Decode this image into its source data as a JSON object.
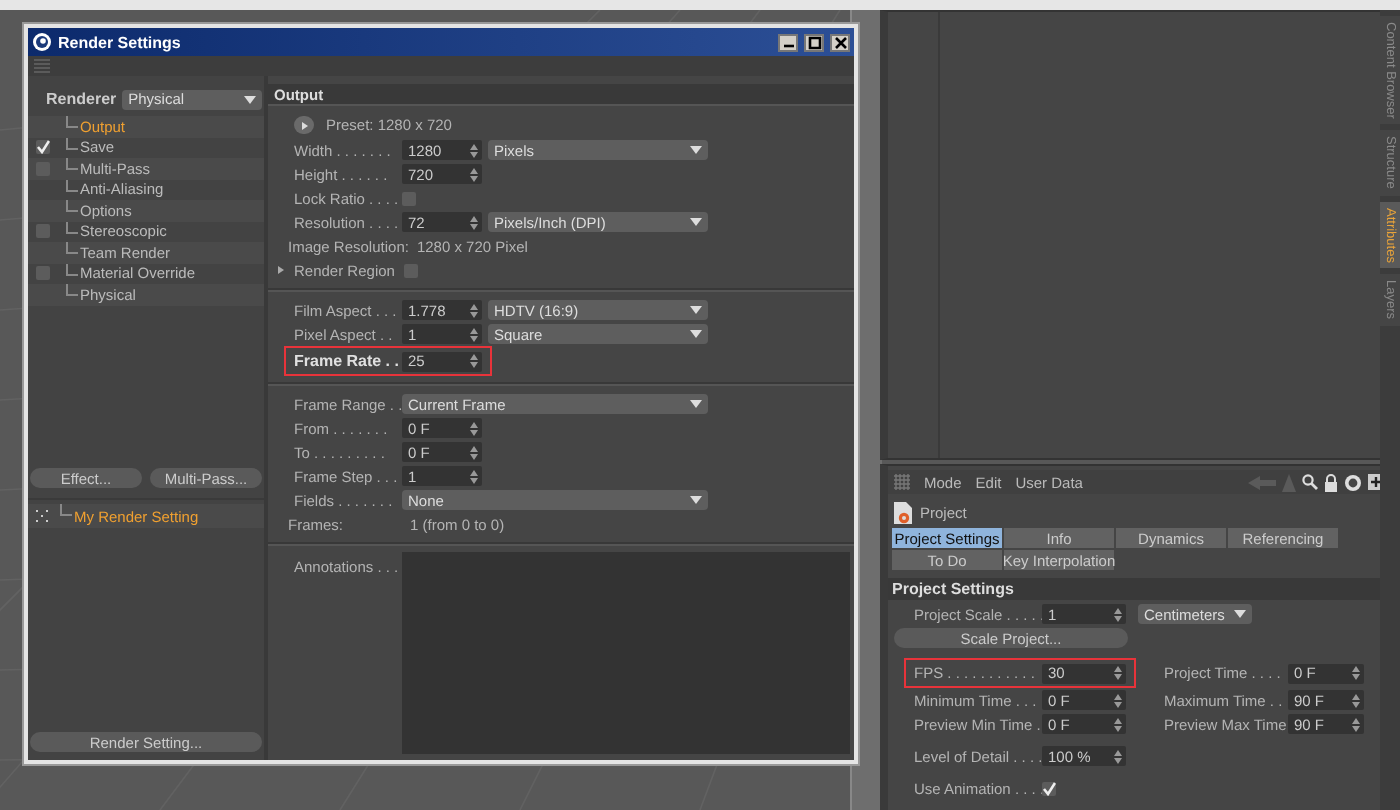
{
  "render_window": {
    "title": "Render Settings",
    "renderer": {
      "label": "Renderer",
      "value": "Physical"
    },
    "effects": [
      {
        "label": "Output",
        "kind": "plain",
        "selected": true
      },
      {
        "label": "Save",
        "kind": "check",
        "checked": true,
        "selected": false
      },
      {
        "label": "Multi-Pass",
        "kind": "check",
        "checked": false,
        "selected": false
      },
      {
        "label": "Anti-Aliasing",
        "kind": "plain",
        "selected": false
      },
      {
        "label": "Options",
        "kind": "plain",
        "selected": false
      },
      {
        "label": "Stereoscopic",
        "kind": "check",
        "checked": false,
        "selected": false
      },
      {
        "label": "Team Render",
        "kind": "plain",
        "selected": false
      },
      {
        "label": "Material Override",
        "kind": "check",
        "checked": false,
        "selected": false
      },
      {
        "label": "Physical",
        "kind": "plain",
        "selected": false
      }
    ],
    "effect_buttons": [
      "Effect...",
      "Multi-Pass..."
    ],
    "settings": [
      {
        "label": "My Render Setting",
        "selected": true
      }
    ],
    "render_setting_button": "Render Setting...",
    "output": {
      "heading": "Output",
      "groups": [
        [
          {
            "kind": "preset",
            "text": "Preset: 1280 x 720"
          },
          {
            "kind": "number",
            "label": "Width . . . . . . .",
            "value": "1280",
            "unit": "Pixels"
          },
          {
            "kind": "number",
            "label": "Height . . . . . .",
            "value": "720"
          },
          {
            "kind": "check",
            "label": "Lock Ratio . . . .",
            "checked": false
          },
          {
            "kind": "number",
            "label": "Resolution . . . .",
            "value": "72",
            "unit": "Pixels/Inch (DPI)"
          },
          {
            "kind": "info",
            "label": "Image Resolution:",
            "value": "1280 x 720 Pixel"
          },
          {
            "kind": "region",
            "label": "Render Region",
            "checked": false
          }
        ],
        [
          {
            "kind": "number",
            "label": "Film Aspect . . .",
            "value": "1.778",
            "unit": "HDTV (16:9)"
          },
          {
            "kind": "number",
            "label": "Pixel Aspect . .",
            "value": "1",
            "unit": "Square"
          },
          {
            "kind": "number",
            "label": "Frame Rate . .",
            "value": "25",
            "highlighted": true,
            "strong": true
          }
        ],
        [
          {
            "kind": "select",
            "label": "Frame Range . .",
            "value": "Current Frame"
          },
          {
            "kind": "number",
            "label": "From . . . . . . .",
            "value": "0 F"
          },
          {
            "kind": "number",
            "label": "To . . . . . . . . .",
            "value": "0 F"
          },
          {
            "kind": "number",
            "label": "Frame Step . . .",
            "value": "1"
          },
          {
            "kind": "select",
            "label": "Fields . . . . . . .",
            "value": "None"
          },
          {
            "kind": "info",
            "label": "Frames:",
            "value": "1 (from 0 to 0)"
          }
        ],
        [
          {
            "kind": "notes",
            "label": "Annotations . . ."
          }
        ]
      ]
    }
  },
  "attribute_manager": {
    "menu": [
      "Mode",
      "Edit",
      "User Data"
    ],
    "object": "Project",
    "tabs": [
      [
        {
          "label": "Project Settings",
          "selected": true
        },
        {
          "label": "Info",
          "selected": false
        },
        {
          "label": "Dynamics",
          "selected": false
        },
        {
          "label": "Referencing",
          "selected": false
        }
      ],
      [
        {
          "label": "To Do",
          "selected": false
        },
        {
          "label": "Key Interpolation",
          "selected": false
        }
      ]
    ],
    "section": "Project Settings",
    "rows": [
      {
        "kind": "number",
        "label": "Project Scale . . . . .",
        "value": "1",
        "unit": "Centimeters"
      },
      {
        "kind": "button",
        "label": "Scale Project..."
      },
      {
        "kind": "pair",
        "left": {
          "label": "FPS . . . . . . . . . . .",
          "value": "30",
          "highlighted": true
        },
        "right": {
          "label": "Project Time . . . .",
          "value": "0 F"
        }
      },
      {
        "kind": "pair",
        "left": {
          "label": "Minimum Time . . .",
          "value": "0 F"
        },
        "right": {
          "label": "Maximum Time . .",
          "value": "90 F"
        }
      },
      {
        "kind": "pair",
        "left": {
          "label": "Preview Min Time .",
          "value": "0 F"
        },
        "right": {
          "label": "Preview Max Time",
          "value": "90 F"
        }
      },
      {
        "kind": "number",
        "label": "Level of Detail . . . .",
        "value": "100 %"
      },
      {
        "kind": "check",
        "label": "Use Animation . . . .",
        "checked": true
      }
    ]
  },
  "side_tabs": {
    "top": [
      {
        "label": "Content Browser",
        "selected": false
      },
      {
        "label": "Structure",
        "selected": false
      }
    ],
    "bottom": [
      {
        "label": "Attributes",
        "selected": true
      },
      {
        "label": "Layers",
        "selected": false
      }
    ]
  }
}
